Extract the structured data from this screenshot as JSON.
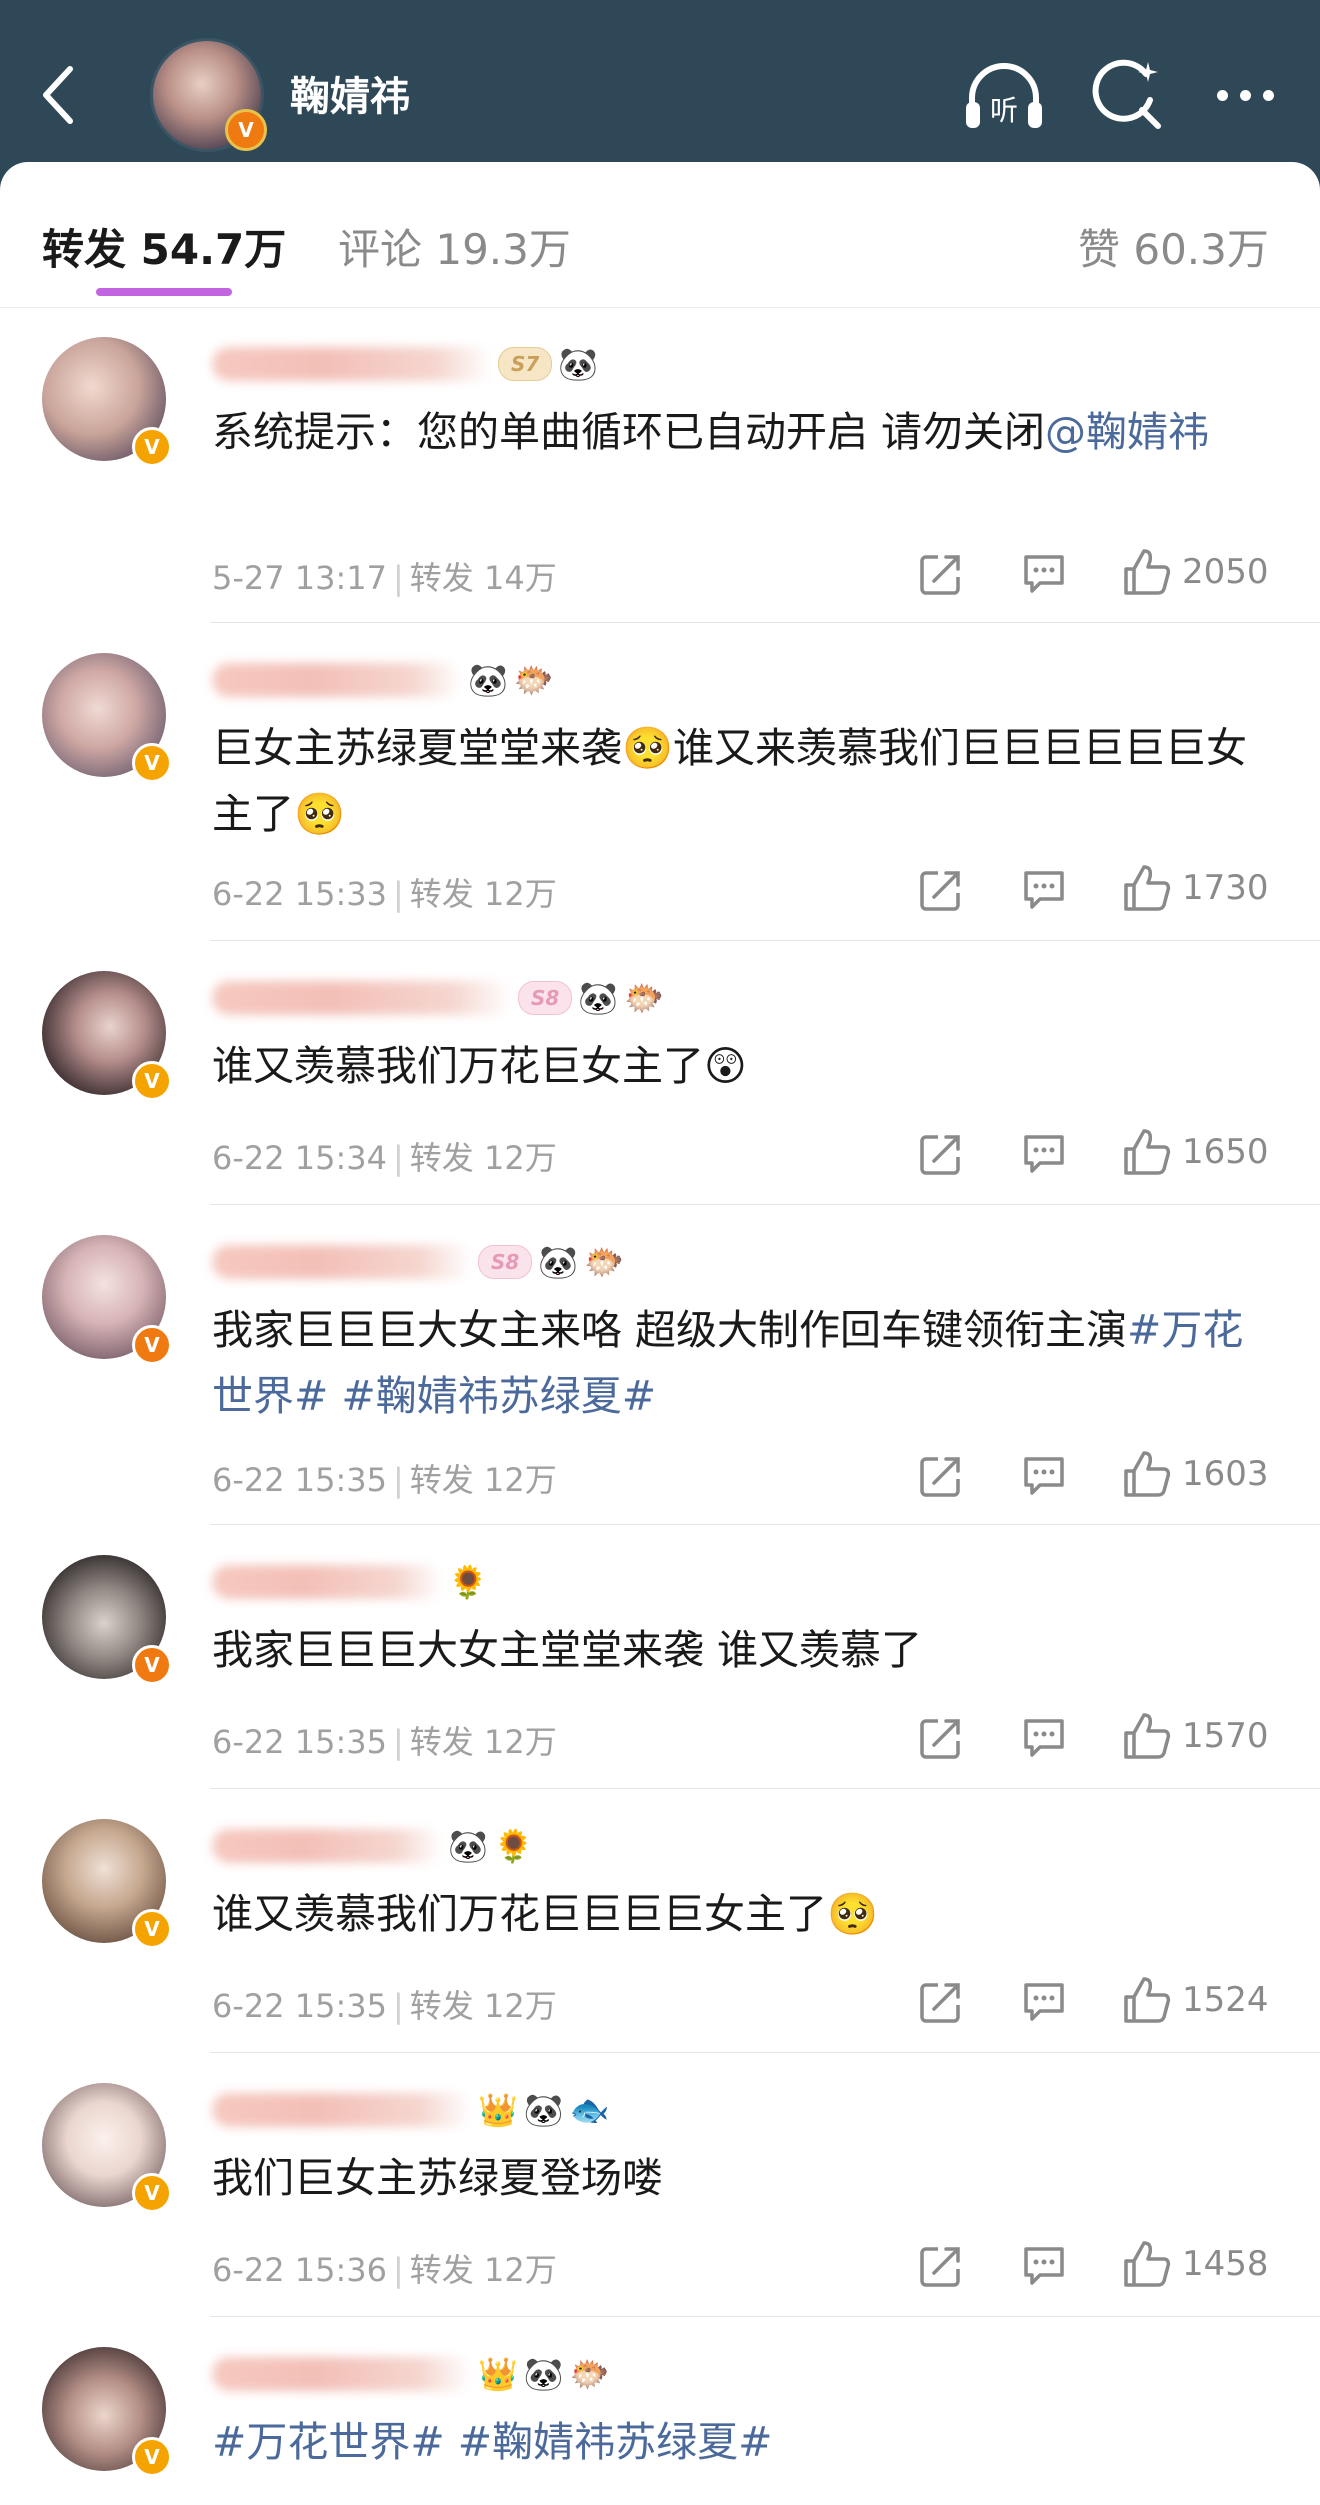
{
  "header": {
    "title": "鞠婧祎",
    "icons": [
      "back-icon",
      "listen-icon",
      "search-icon",
      "more-icon"
    ],
    "listen_label": "听"
  },
  "tabs": [
    {
      "label": "转发 54.7万",
      "active": true
    },
    {
      "label": "评论 19.3万",
      "active": false
    },
    {
      "label": "赞 60.3万",
      "active": false
    }
  ],
  "colors": {
    "topbar": "#2f4858",
    "tab_underline": "#c264e0",
    "link": "#4b6a9b",
    "verified": "#f5a300"
  },
  "items": [
    {
      "badge": "S7",
      "emojis": [
        "🐼"
      ],
      "content_parts": [
        {
          "text": "系统提示：您的单曲循环已自动开启 请勿关闭",
          "link": false
        },
        {
          "text": "@鞠婧祎",
          "link": true
        }
      ],
      "time": "5-27 13:17",
      "repost": "转发 14万",
      "likes": "2050"
    },
    {
      "badge": "",
      "emojis": [
        "🐼",
        "🐡"
      ],
      "content_parts": [
        {
          "text": "巨女主苏绿夏堂堂来袭🥺谁又来羡慕我们巨巨巨巨巨巨女主了🥺",
          "link": false
        }
      ],
      "time": "6-22 15:33",
      "repost": "转发 12万",
      "likes": "1730"
    },
    {
      "badge": "S8",
      "emojis": [
        "🐼",
        "🐡"
      ],
      "content_parts": [
        {
          "text": "谁又羡慕我们万花巨女主了😲",
          "link": false
        }
      ],
      "time": "6-22 15:34",
      "repost": "转发 12万",
      "likes": "1650"
    },
    {
      "badge": "S8",
      "emojis": [
        "🐼",
        "🐡"
      ],
      "content_parts": [
        {
          "text": "我家巨巨巨大女主来咯 超级大制作回车键领衔主演",
          "link": false
        },
        {
          "text": "#万花世界#",
          "link": true
        },
        {
          "text": " ",
          "link": false
        },
        {
          "text": "#鞠婧祎苏绿夏#",
          "link": true
        }
      ],
      "time": "6-22 15:35",
      "repost": "转发 12万",
      "likes": "1603"
    },
    {
      "badge": "",
      "emojis": [
        "🌻"
      ],
      "content_parts": [
        {
          "text": "我家巨巨巨大女主堂堂来袭 谁又羡慕了",
          "link": false
        }
      ],
      "time": "6-22 15:35",
      "repost": "转发 12万",
      "likes": "1570"
    },
    {
      "badge": "",
      "emojis": [
        "🐼",
        "🌻"
      ],
      "content_parts": [
        {
          "text": "谁又羡慕我们万花巨巨巨巨女主了🥺",
          "link": false
        }
      ],
      "time": "6-22 15:35",
      "repost": "转发 12万",
      "likes": "1524"
    },
    {
      "badge": "",
      "emojis": [
        "👑",
        "🐼",
        "🐟"
      ],
      "content_parts": [
        {
          "text": "我们巨女主苏绿夏登场喽",
          "link": false
        }
      ],
      "time": "6-22 15:36",
      "repost": "转发 12万",
      "likes": "1458"
    },
    {
      "badge": "",
      "emojis": [
        "👑",
        "🐼",
        "🐡"
      ],
      "content_parts": [
        {
          "text": "#万花世界#",
          "link": true
        },
        {
          "text": " ",
          "link": false
        },
        {
          "text": "#鞠婧祎苏绿夏#",
          "link": true
        }
      ],
      "time": "",
      "repost": "",
      "likes": ""
    }
  ]
}
